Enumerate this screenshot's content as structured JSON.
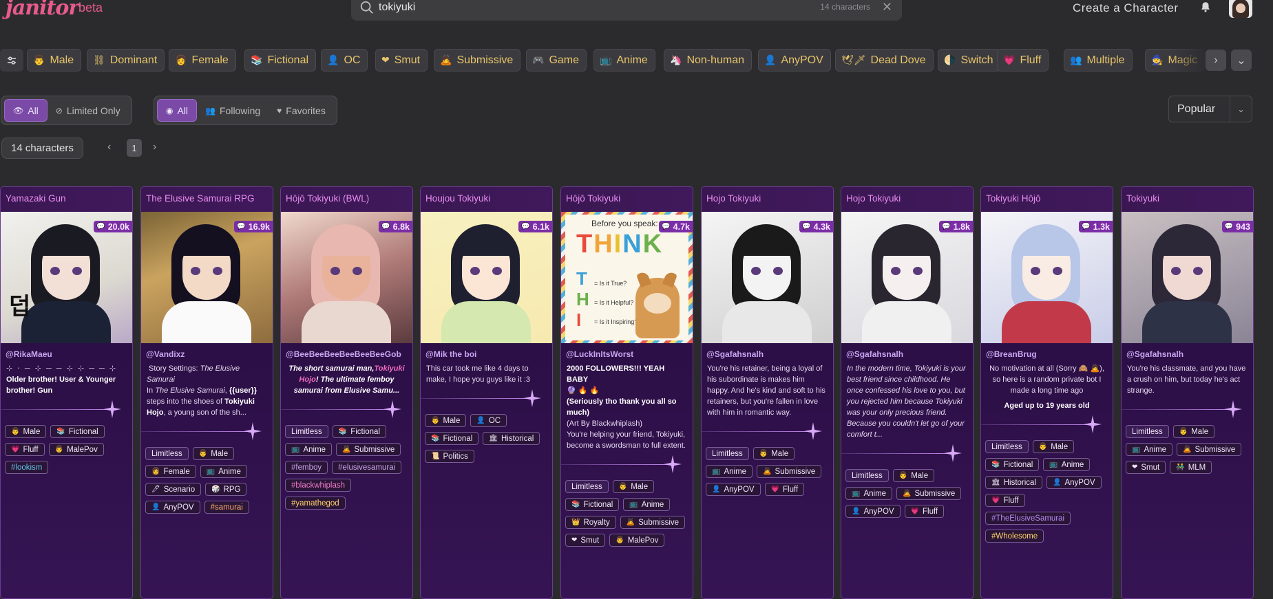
{
  "header": {
    "logo": "janitor",
    "logo_badge": "beta",
    "search": {
      "value": "tokiyuki",
      "count": "14 characters"
    },
    "create_label": "Create a Character"
  },
  "tag_filters": [
    {
      "emoji": "👨",
      "label": "Male"
    },
    {
      "emoji": "⛓",
      "label": "Dominant"
    },
    {
      "emoji": "👩",
      "label": "Female"
    },
    {
      "emoji": "📚",
      "label": "Fictional"
    },
    {
      "emoji": "👤",
      "label": "OC"
    },
    {
      "emoji": "❤",
      "label": "Smut"
    },
    {
      "emoji": "🙇",
      "label": "Submissive"
    },
    {
      "emoji": "🎮",
      "label": "Game"
    },
    {
      "emoji": "📺",
      "label": "Anime"
    },
    {
      "emoji": "🦄",
      "label": "Non-human"
    },
    {
      "emoji": "👤",
      "label": "AnyPOV"
    },
    {
      "emoji": "🕊🗡",
      "label": "Dead Dove"
    },
    {
      "emoji": "🌗",
      "label": "Switch"
    },
    {
      "emoji": "💗",
      "label": "Fluff"
    },
    {
      "emoji": "👥",
      "label": "Multiple"
    },
    {
      "emoji": "🧙",
      "label": "Magic"
    }
  ],
  "visibility_filter": {
    "all": "All",
    "limited": "Limited Only"
  },
  "scope_filter": {
    "all": "All",
    "following": "Following",
    "favorites": "Favorites"
  },
  "sort": {
    "selected": "Popular"
  },
  "results": {
    "count_label": "14 characters",
    "page": "1"
  },
  "cards": [
    {
      "title": "Yamazaki Gun",
      "badge": "20.0k",
      "creator": "@RikaMaeu",
      "desc_html": "<span style='letter-spacing:2px;color:#cfc2e0'>⊹ ⋅ ─ ⊹ ─ ─ ⊹ ⊹ ─ ─ ⊹</span><br><b>Older brother! User &amp; Younger brother! Gun</b>",
      "tags": [
        [
          "👨",
          "Male",
          ""
        ],
        [
          "📚",
          "Fictional",
          ""
        ],
        [
          "💗",
          "Fluff",
          ""
        ],
        [
          "👨",
          "MalePov",
          ""
        ],
        [
          "",
          "#lookism",
          "hashtag-c"
        ]
      ]
    },
    {
      "title": "The Elusive Samurai RPG",
      "badge": "16.9k",
      "creator": "@Vandixz",
      "desc_html": "&nbsp;Story Settings: <i>The Elusive Samurai</i><br>In <i>The Elusive Samurai</i>, <b>{{user}}</b> steps into the shoes of <b>Tokiyuki Hojo</b>, a young son of the sh...",
      "tags": [
        [
          "",
          "Limitless",
          "limitless"
        ],
        [
          "👨",
          "Male",
          ""
        ],
        [
          "👩",
          "Female",
          ""
        ],
        [
          "📺",
          "Anime",
          ""
        ],
        [
          "🖊",
          "Scenario",
          ""
        ],
        [
          "🎲",
          "RPG",
          ""
        ],
        [
          "👤",
          "AnyPOV",
          ""
        ],
        [
          "",
          "#samurai",
          "hashtag-o"
        ]
      ]
    },
    {
      "title": "Hōjō Tokiyuki (BWL)",
      "badge": "6.8k",
      "creator": "@BeeBeeBeeBeeBeeBeeGob",
      "desc_html": "<div style='text-align:center'><b><i>The short samurai man,<span style='color:#f06cc0'>Tokiyuki Hojo</span>! The ultimate femboy samurai from Elusive Samu...</i></b></div>",
      "tags": [
        [
          "",
          "Limitless",
          "limitless"
        ],
        [
          "📚",
          "Fictional",
          ""
        ],
        [
          "📺",
          "Anime",
          ""
        ],
        [
          "🙇",
          "Submissive",
          ""
        ],
        [
          "",
          "#femboy",
          "hashtag-d"
        ],
        [
          "",
          "#elusivesamurai",
          "hashtag-d"
        ],
        [
          "",
          "#blackwhiplash",
          "hashtag-p"
        ],
        [
          "",
          "#yamathegod",
          "hashtag-y"
        ]
      ]
    },
    {
      "title": "Houjou Tokiyuki",
      "badge": "6.1k",
      "creator": "@Mik the boi",
      "desc_html": "This car took me like 4 days to make, I hope you guys like it :3",
      "tags": [
        [
          "👨",
          "Male",
          ""
        ],
        [
          "👤",
          "OC",
          ""
        ],
        [
          "📚",
          "Fictional",
          ""
        ],
        [
          "🏛",
          "Historical",
          ""
        ],
        [
          "📜",
          "Politics",
          ""
        ]
      ]
    },
    {
      "title": "Hōjō Tokiyuki",
      "badge": "4.7k",
      "creator": "@LuckInItsWorst",
      "desc_html": "<b>2000 FOLLOWERS!!! YEAH BABY</b><br>🔮 🔥 🔥<br><b>(Seriously tho thank you all so much)</b><br>(Art By Blackwhiplash)<br>You're helping your friend, Tokiyuki, become a swordsman to full extent.",
      "tags": [
        [
          "",
          "Limitless",
          "limitless"
        ],
        [
          "👨",
          "Male",
          ""
        ],
        [
          "📚",
          "Fictional",
          ""
        ],
        [
          "📺",
          "Anime",
          ""
        ],
        [
          "👑",
          "Royalty",
          ""
        ],
        [
          "🙇",
          "Submissive",
          ""
        ],
        [
          "❤",
          "Smut",
          ""
        ],
        [
          "👨",
          "MalePov",
          ""
        ]
      ]
    },
    {
      "title": "Hojo Tokiyuki",
      "badge": "4.3k",
      "creator": "@Sgafahsnalh",
      "desc_html": "You're his retainer, being a loyal of his subordinate is makes him happy. And he's kind and soft to his retainers, but you're fallen in love with him in romantic way.",
      "tags": [
        [
          "",
          "Limitless",
          "limitless"
        ],
        [
          "👨",
          "Male",
          ""
        ],
        [
          "📺",
          "Anime",
          ""
        ],
        [
          "🙇",
          "Submissive",
          ""
        ],
        [
          "👤",
          "AnyPOV",
          ""
        ],
        [
          "💗",
          "Fluff",
          ""
        ]
      ]
    },
    {
      "title": "Hojo Tokiyuki",
      "badge": "1.8k",
      "creator": "@Sgafahsnalh",
      "desc_html": "<i>In the modern time, Tokiyuki is your best friend since childhood. He once confessed his love to you, but you rejected him because Tokiyuki was your only precious friend. Because you couldn't let go of your comfort t...</i>",
      "tags": [
        [
          "",
          "Limitless",
          "limitless"
        ],
        [
          "👨",
          "Male",
          ""
        ],
        [
          "📺",
          "Anime",
          ""
        ],
        [
          "🙇",
          "Submissive",
          ""
        ],
        [
          "👤",
          "AnyPOV",
          ""
        ],
        [
          "💗",
          "Fluff",
          ""
        ]
      ]
    },
    {
      "title": "Tokiyuki Hōjō",
      "badge": "1.3k",
      "creator": "@BreanBrug",
      "desc_html": "<div style='text-align:center'>No motivation at all (Sorry 🙈 🙇), so here is a random private bot I made a long time ago<br><b style='display:block;margin-top:6px'>Aged up to 19 years old</b></div>",
      "tags": [
        [
          "",
          "Limitless",
          "limitless"
        ],
        [
          "👨",
          "Male",
          ""
        ],
        [
          "📚",
          "Fictional",
          ""
        ],
        [
          "📺",
          "Anime",
          ""
        ],
        [
          "🏛",
          "Historical",
          ""
        ],
        [
          "👤",
          "AnyPOV",
          ""
        ],
        [
          "💗",
          "Fluff",
          ""
        ],
        [
          "",
          "#TheElusiveSamurai",
          "hashtag-m"
        ],
        [
          "",
          "#Wholesome",
          "hashtag-y"
        ]
      ]
    },
    {
      "title": "Tokiyuki",
      "badge": "943",
      "creator": "@Sgafahsnalh",
      "desc_html": "You're his classmate, and you have a crush on him, but today he's act strange.",
      "tags": [
        [
          "",
          "Limitless",
          "limitless"
        ],
        [
          "👨",
          "Male",
          ""
        ],
        [
          "📺",
          "Anime",
          ""
        ],
        [
          "🙇",
          "Submissive",
          ""
        ],
        [
          "❤",
          "Smut",
          ""
        ],
        [
          "👬",
          "MLM",
          ""
        ]
      ]
    }
  ]
}
